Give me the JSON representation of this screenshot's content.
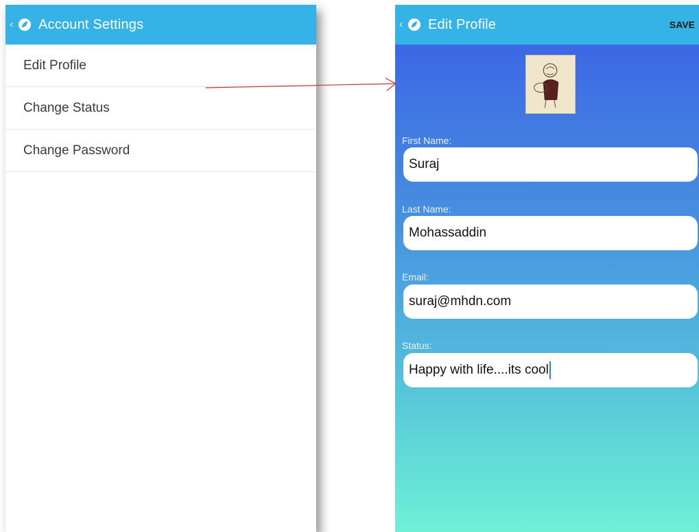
{
  "left_screen": {
    "title": "Account Settings",
    "items": [
      {
        "label": "Edit Profile"
      },
      {
        "label": "Change Status"
      },
      {
        "label": "Change Password"
      }
    ]
  },
  "right_screen": {
    "title": "Edit Profile",
    "save_label": "SAVE",
    "fields": {
      "first_name": {
        "label": "First Name:",
        "value": "Suraj"
      },
      "last_name": {
        "label": "Last Name:",
        "value": "Mohassaddin"
      },
      "email": {
        "label": "Email:",
        "value": "suraj@mhdn.com"
      },
      "status": {
        "label": "Status:",
        "value": "Happy with life....its cool"
      }
    }
  },
  "colors": {
    "appbar": "#36b3e6",
    "arrow": "#c0392b",
    "gradient_top": "#3a5fe6",
    "gradient_bottom": "#6ff0d6"
  },
  "icons": {
    "back": "chevron-left-icon",
    "app": "leaf-icon"
  }
}
